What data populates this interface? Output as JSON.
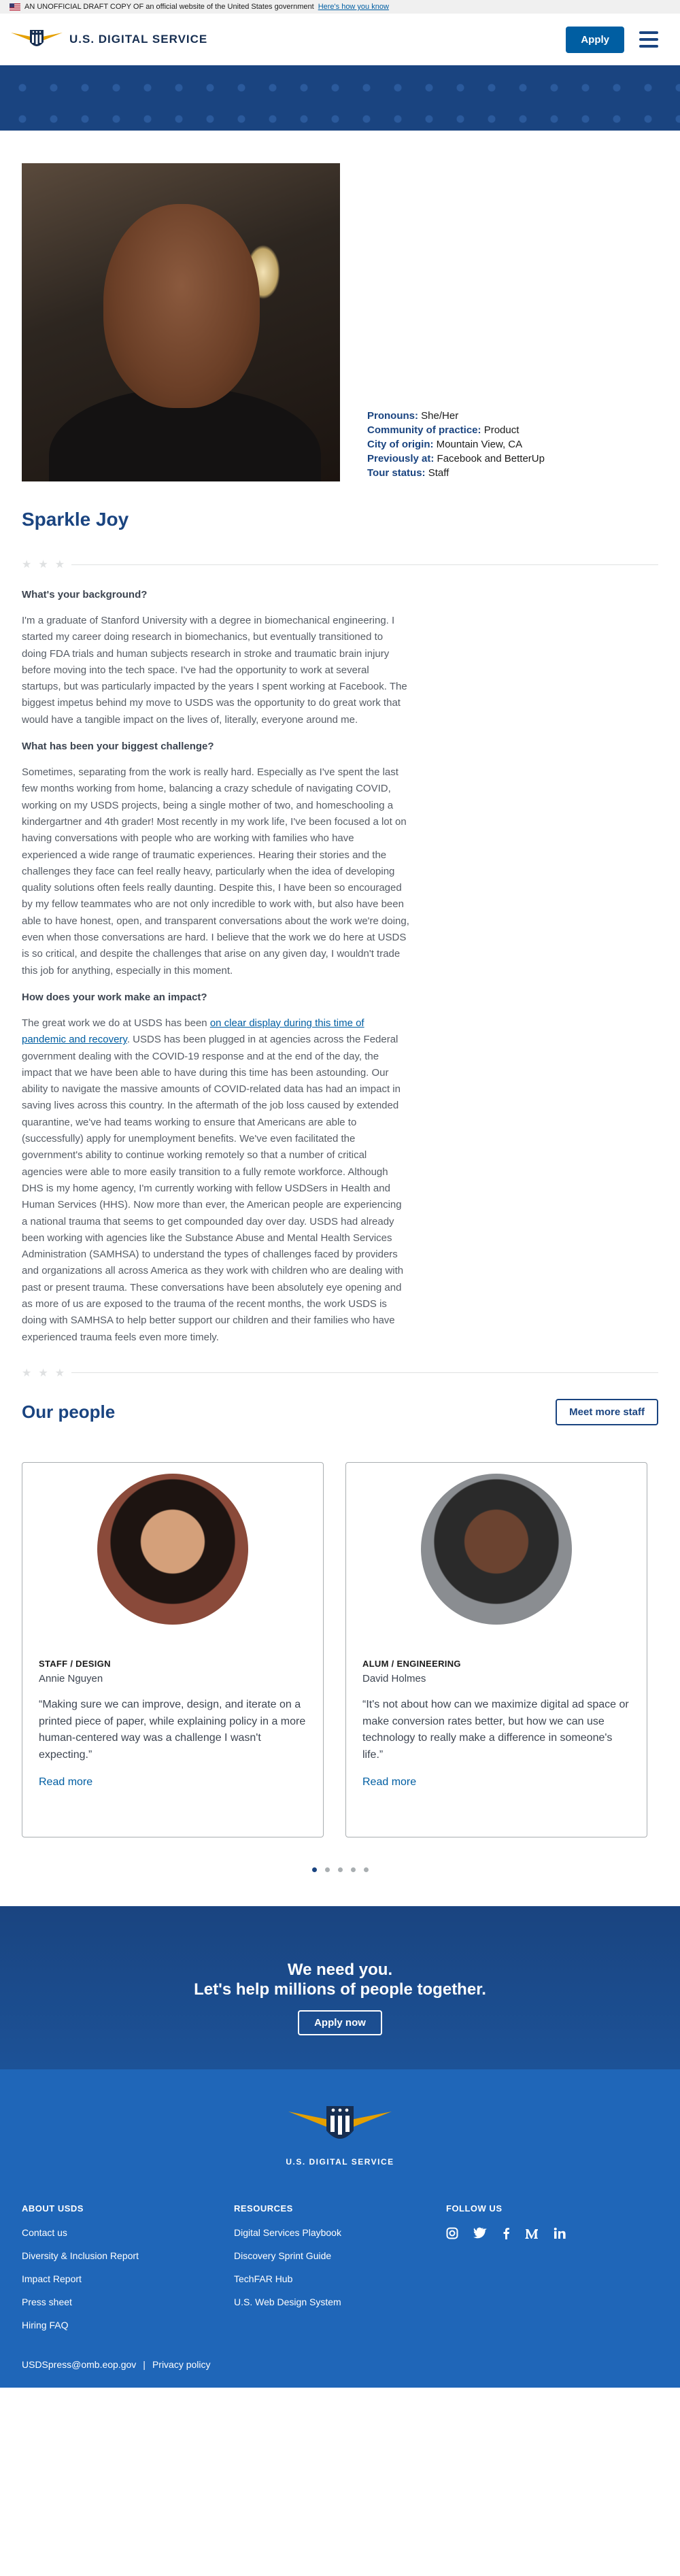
{
  "banner": {
    "text": "AN UNOFFICIAL DRAFT COPY OF an official website of the United States government",
    "link": "Here's how you know"
  },
  "header": {
    "site_name": "U.S. DIGITAL SERVICE",
    "apply_label": "Apply"
  },
  "profile": {
    "name": "Sparkle Joy",
    "facts": [
      {
        "label": "Pronouns:",
        "value": "She/Her"
      },
      {
        "label": "Community of practice:",
        "value": "Product"
      },
      {
        "label": "City of origin:",
        "value": "Mountain View, CA"
      },
      {
        "label": "Previously at:",
        "value": "Facebook and BetterUp"
      },
      {
        "label": "Tour status:",
        "value": "Staff"
      }
    ],
    "q1": "What's your background?",
    "a1": "I'm a graduate of Stanford University with a degree in biomechanical engineering. I started my career doing research in biomechanics, but eventually transitioned to doing FDA trials and human subjects research in stroke and traumatic brain injury before moving into the tech space. I've had the opportunity to work at several startups, but was particularly impacted by the years I spent working at Facebook. The biggest impetus behind my move to USDS was the opportunity to do great work that would have a tangible impact on the lives of, literally, everyone around me.",
    "q2": "What has been your biggest challenge?",
    "a2": "Sometimes, separating from the work is really hard. Especially as I've spent the last few months working from home, balancing a crazy schedule of navigating COVID, working on my USDS projects, being a single mother of two, and homeschooling a kindergartner and 4th grader! Most recently in my work life, I've been focused a lot on having conversations with people who are working with families who have experienced a wide range of traumatic experiences. Hearing their stories and the challenges they face can feel really heavy, particularly when the idea of developing quality solutions often feels really daunting. Despite this, I have been so encouraged by my fellow teammates who are not only incredible to work with, but also have been able to have honest, open, and transparent conversations about the work we're doing, even when those conversations are hard. I believe that the work we do here at USDS is so critical, and despite the challenges that arise on any given day, I wouldn't trade this job for anything, especially in this moment.",
    "q3": "How does your work make an impact?",
    "a3_pre": "The great work we do at USDS has been ",
    "a3_link": "on clear display during this time of pandemic and recovery",
    "a3_post": ". USDS has been plugged in at agencies across the Federal government dealing with the COVID-19 response and at the end of the day, the impact that we have been able to have during this time has been astounding. Our ability to navigate the massive amounts of COVID-related data has had an impact in saving lives across this country. In the aftermath of the job loss caused by extended quarantine, we've had teams working to ensure that Americans are able to (successfully) apply for unemployment benefits. We've even facilitated the government's ability to continue working remotely so that a number of critical agencies were able to more easily transition to a fully remote workforce. Although DHS is my home agency, I'm currently working with fellow USDSers in Health and Human Services (HHS). Now more than ever, the American people are experiencing a national trauma that seems to get compounded day over day. USDS had already been working with agencies like the Substance Abuse and Mental Health Services Administration (SAMHSA) to understand the types of challenges faced by providers and organizations all across America as they work with children who are dealing with past or present trauma. These conversations have been absolutely eye opening and as more of us are exposed to the trauma of the recent months, the work USDS is doing with SAMHSA to help better support our children and their families who have experienced trauma feels even more timely."
  },
  "people": {
    "heading": "Our people",
    "more_label": "Meet more staff",
    "cards": [
      {
        "role": "STAFF / DESIGN",
        "name": "Annie Nguyen",
        "quote": "“Making sure we can improve, design, and iterate on a printed piece of paper, while explaining policy in a more human-centered way was a challenge I wasn't expecting.”",
        "link": "Read more"
      },
      {
        "role": "ALUM / ENGINEERING",
        "name": "David Holmes",
        "quote": "“It's not about how can we maximize digital ad space or make conversion rates better, but how we can use technology to really make a difference in someone's life.”",
        "link": "Read more"
      }
    ]
  },
  "cta": {
    "line1": "We need you.",
    "line2": "Let's help millions of people together.",
    "button": "Apply now"
  },
  "footer": {
    "wordmark": "U.S. DIGITAL SERVICE",
    "col1_title": "ABOUT USDS",
    "col1": [
      "Contact us",
      "Diversity & Inclusion Report",
      "Impact Report",
      "Press sheet",
      "Hiring FAQ"
    ],
    "col2_title": "RESOURCES",
    "col2": [
      "Digital Services Playbook",
      "Discovery Sprint Guide",
      "TechFAR Hub",
      "U.S. Web Design System"
    ],
    "col3_title": "FOLLOW US",
    "email": "USDSpress@omb.eop.gov",
    "sep": "|",
    "privacy": "Privacy policy"
  }
}
